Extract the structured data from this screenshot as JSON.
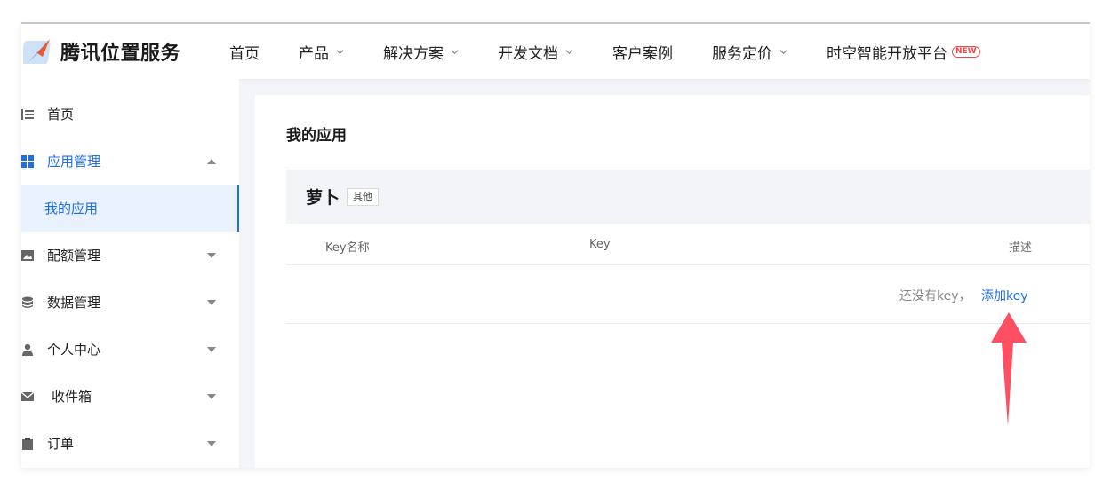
{
  "brand": {
    "name": "腾讯位置服务"
  },
  "topnav": {
    "items": [
      {
        "label": "首页",
        "has_dropdown": false
      },
      {
        "label": "产品",
        "has_dropdown": true
      },
      {
        "label": "解决方案",
        "has_dropdown": true
      },
      {
        "label": "开发文档",
        "has_dropdown": true
      },
      {
        "label": "客户案例",
        "has_dropdown": false
      },
      {
        "label": "服务定价",
        "has_dropdown": true
      },
      {
        "label": "时空智能开放平台",
        "has_dropdown": false,
        "badge": "NEW"
      }
    ]
  },
  "sidebar": {
    "items": [
      {
        "label": "首页",
        "icon": "list-icon"
      },
      {
        "label": "应用管理",
        "icon": "grid-icon",
        "expanded": true,
        "sub": [
          {
            "label": "我的应用",
            "active": true
          }
        ]
      },
      {
        "label": "配额管理",
        "icon": "image-icon"
      },
      {
        "label": "数据管理",
        "icon": "database-icon"
      },
      {
        "label": "个人中心",
        "icon": "user-icon"
      },
      {
        "label": "收件箱",
        "icon": "mail-icon"
      },
      {
        "label": "订单",
        "icon": "clipboard-icon"
      }
    ]
  },
  "main": {
    "title": "我的应用",
    "app": {
      "name": "萝卜",
      "tag": "其他"
    },
    "table": {
      "columns": [
        "Key名称",
        "Key",
        "描述"
      ],
      "empty_text": "还没有key，",
      "add_link": "添加key"
    }
  },
  "colors": {
    "accent": "#1f6fe5",
    "annotation": "#ff4f63",
    "badge": "#f04848"
  }
}
